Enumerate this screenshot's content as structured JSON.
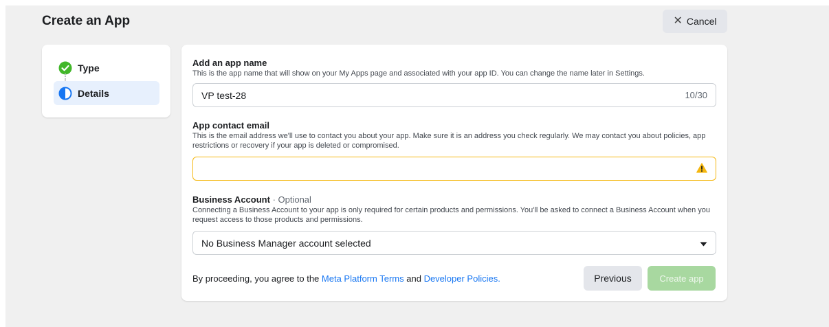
{
  "header": {
    "title": "Create an App",
    "cancel_label": "Cancel",
    "cancel_icon": "close-icon"
  },
  "steps": [
    {
      "label": "Type",
      "status": "complete",
      "icon": "check-circle-icon"
    },
    {
      "label": "Details",
      "status": "current",
      "icon": "half-circle-icon"
    }
  ],
  "form": {
    "app_name": {
      "label": "Add an app name",
      "help": "This is the app name that will show on your My Apps page and associated with your app ID. You can change the name later in Settings.",
      "value": "VP test-28",
      "counter": "10/30"
    },
    "contact_email": {
      "label": "App contact email",
      "help": "This is the email address we'll use to contact you about your app. Make sure it is an address you check regularly. We may contact you about policies, app restrictions or recovery if your app is deleted or compromised.",
      "value": "",
      "status_icon": "warning-icon"
    },
    "business_account": {
      "label": "Business Account",
      "optional": "· Optional",
      "help": "Connecting a Business Account to your app is only required for certain products and permissions. You'll be asked to connect a Business Account when you request access to those products and permissions.",
      "selected": "No Business Manager account selected"
    },
    "terms": {
      "prefix": "By proceeding, you agree to the",
      "link1": "Meta Platform Terms",
      "middle": "and",
      "link2": "Developer Policies."
    },
    "previous_label": "Previous",
    "create_label": "Create app"
  },
  "colors": {
    "accent": "#1877f2",
    "success": "#42b72a",
    "warning": "#f5b70f",
    "create_disabled": "#a8d8a0"
  }
}
